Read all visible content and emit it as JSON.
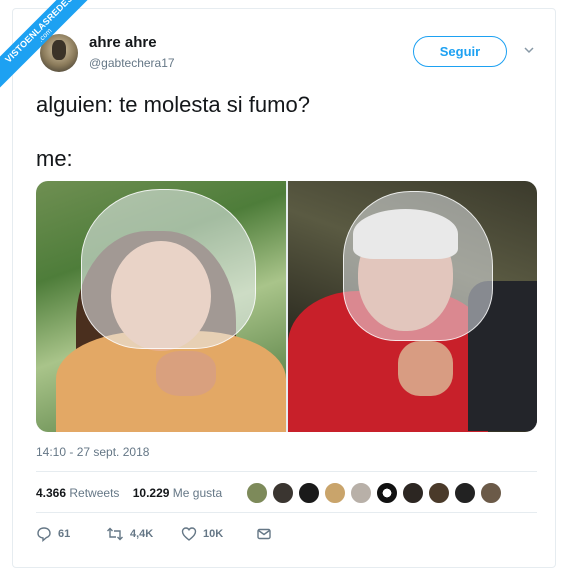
{
  "watermark": {
    "line1": "VISTOENLASREDES",
    "line2": ".com"
  },
  "tweet": {
    "display_name": "ahre ahre",
    "handle": "@gabtechera17",
    "follow_label": "Seguir",
    "text_line1": "alguien: te molesta si fumo?",
    "text_line2": "me:",
    "timestamp": "14:10 - 27 sept. 2018",
    "retweets_count": "4.366",
    "retweets_label": "Retweets",
    "likes_count": "10.229",
    "likes_label": "Me gusta",
    "actions": {
      "reply": "61",
      "retweet": "4,4K",
      "like": "10K"
    }
  },
  "colors": {
    "accent": "#1da1f2",
    "muted": "#657786",
    "text": "#14171a",
    "border": "#e6ecf0"
  },
  "icons": [
    "chevron-down-icon",
    "reply-icon",
    "retweet-icon",
    "heart-icon",
    "message-icon"
  ]
}
